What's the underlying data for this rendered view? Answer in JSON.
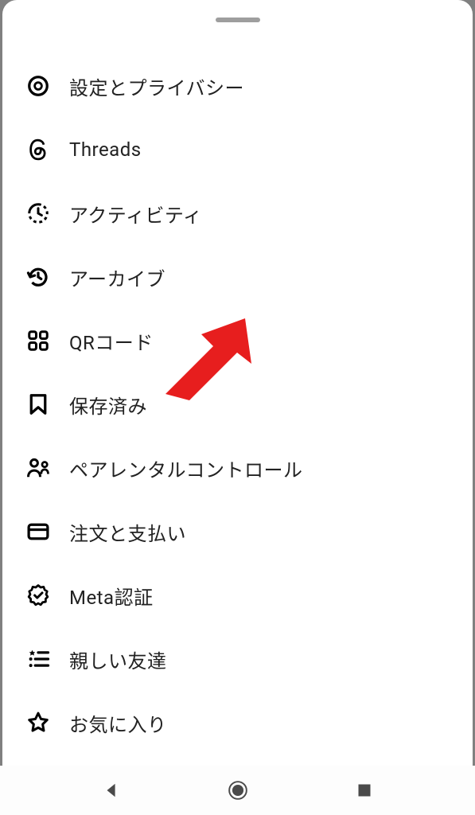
{
  "menu": {
    "items": [
      {
        "id": "settings",
        "label": "設定とプライバシー",
        "icon": "gear"
      },
      {
        "id": "threads",
        "label": "Threads",
        "icon": "threads"
      },
      {
        "id": "activity",
        "label": "アクティビティ",
        "icon": "activity"
      },
      {
        "id": "archive",
        "label": "アーカイブ",
        "icon": "archive"
      },
      {
        "id": "qrcode",
        "label": "QRコード",
        "icon": "qr"
      },
      {
        "id": "saved",
        "label": "保存済み",
        "icon": "bookmark"
      },
      {
        "id": "parental",
        "label": "ペアレンタルコントロール",
        "icon": "supervise"
      },
      {
        "id": "orders",
        "label": "注文と支払い",
        "icon": "card"
      },
      {
        "id": "verified",
        "label": "Meta認証",
        "icon": "verified"
      },
      {
        "id": "close-friends",
        "label": "親しい友達",
        "icon": "starlist"
      },
      {
        "id": "favorites",
        "label": "お気に入り",
        "icon": "star"
      }
    ]
  },
  "annotation": {
    "arrow_color": "#e71e1e",
    "target": "saved"
  }
}
